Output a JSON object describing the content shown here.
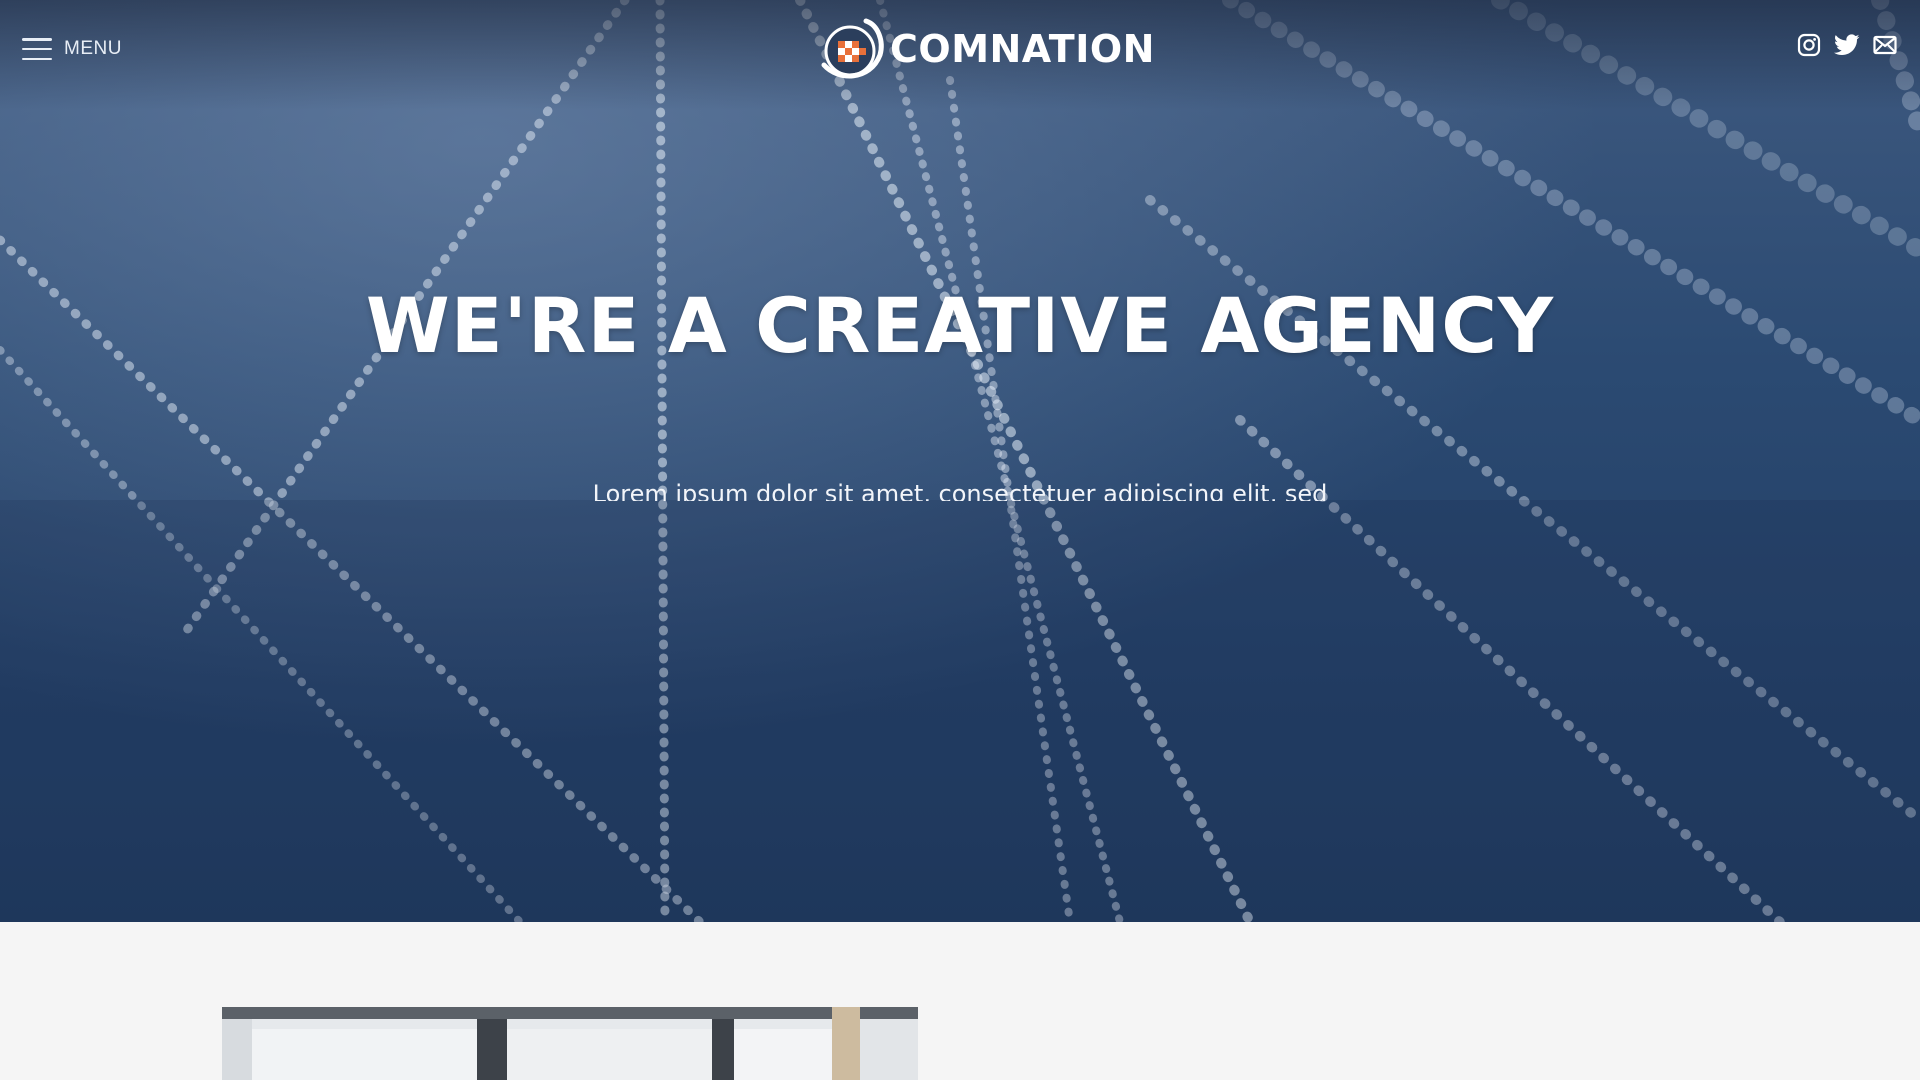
{
  "header": {
    "menu_label": "MENU",
    "brand_name": "COMNATION",
    "social": [
      "instagram-icon",
      "twitter-icon",
      "mail-icon"
    ]
  },
  "hero": {
    "title": "WE'RE A CREATIVE AGENCY",
    "subtitle": "Lorem ipsum dolor sit amet, consectetuer adipiscing elit, sed"
  },
  "colors": {
    "hero_top": "#3f5a80",
    "hero_bottom": "#1f3a5f",
    "page_bg": "#f5f5f5",
    "text": "#ffffff",
    "logo_accent": "#e8703a"
  }
}
